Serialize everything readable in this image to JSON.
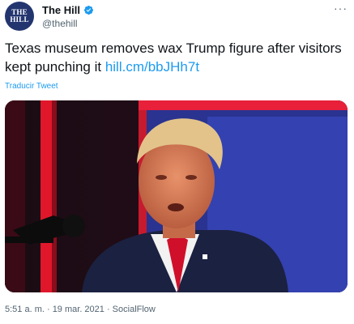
{
  "account": {
    "avatar_line1": "THE",
    "avatar_line2": "HILL",
    "name": "The Hill",
    "handle": "@thehill"
  },
  "tweet": {
    "text": "Texas museum removes wax Trump figure after visitors kept punching it",
    "link": "hill.cm/bbJHh7t",
    "translate_label": "Traducir Tweet",
    "timestamp": "5:51 a. m. · 19 mar. 2021 · SocialFlow"
  },
  "menu": {
    "more_label": "···"
  },
  "colors": {
    "accent": "#1d9bf0",
    "avatar_bg": "#23356f",
    "stage_red": "#e0172a",
    "stage_blue": "#2d3a9c"
  },
  "icons": {
    "verified": "verified-badge-icon",
    "more": "more-options-icon"
  }
}
